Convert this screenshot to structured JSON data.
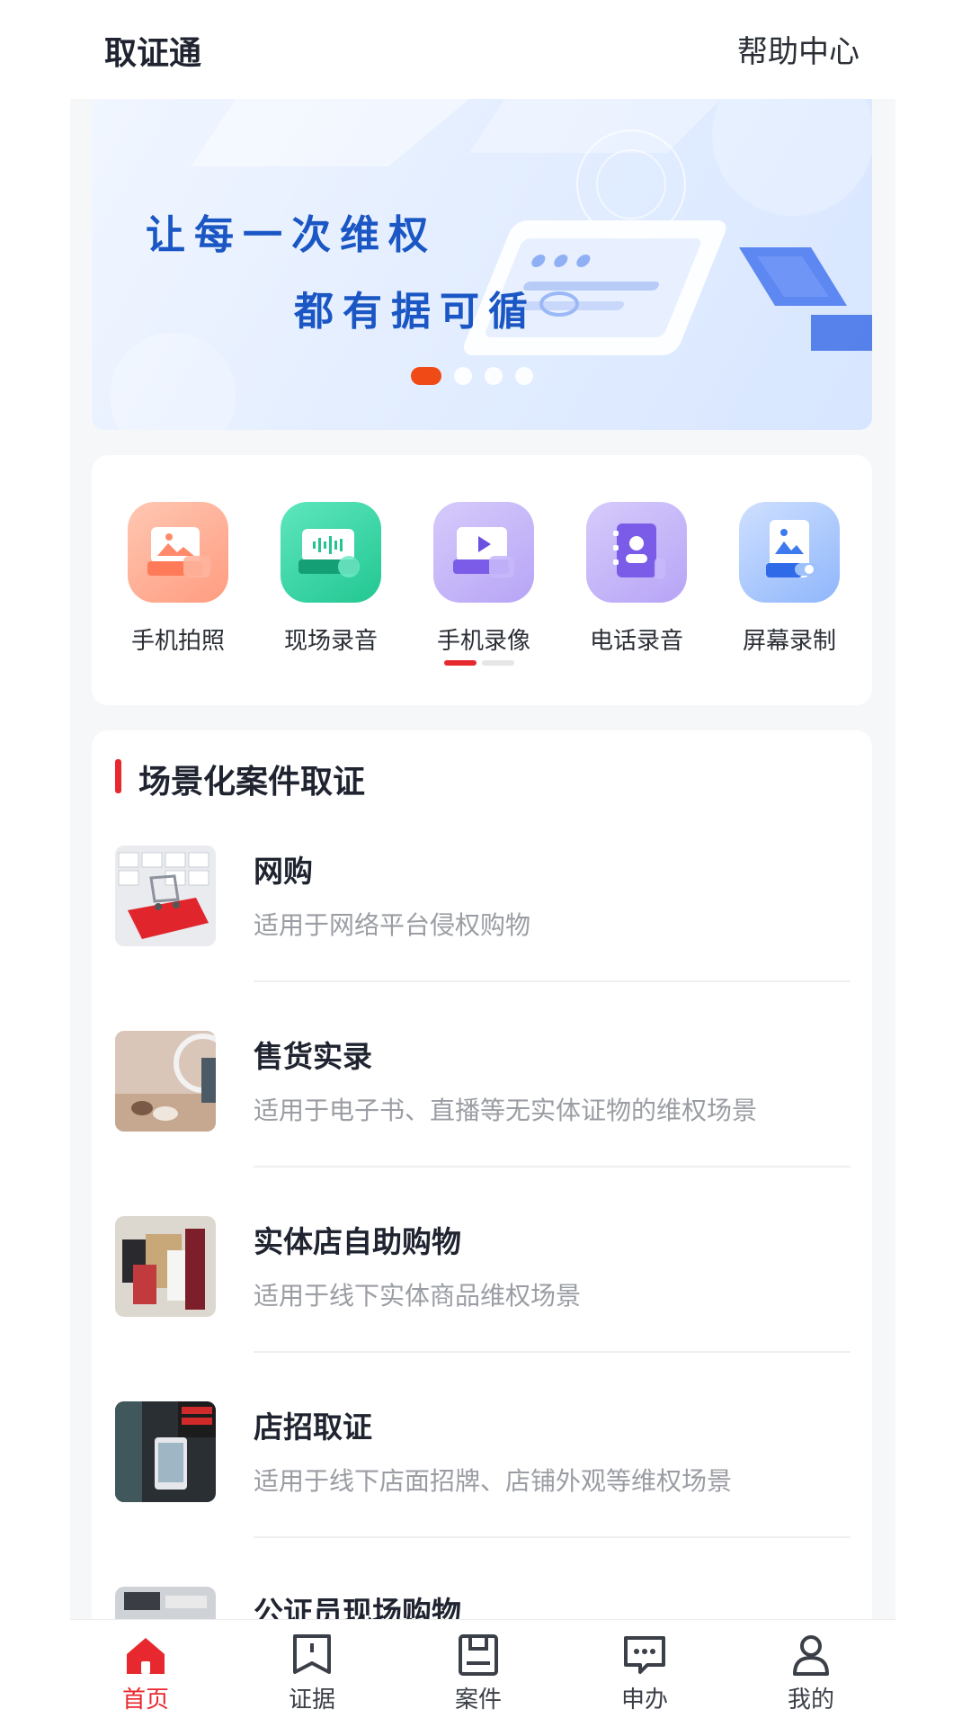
{
  "header": {
    "title": "取证通",
    "help": "帮助中心"
  },
  "banner": {
    "line1": "让每一次维权",
    "line2": "都有据可循",
    "slides": 4,
    "active_slide": 1
  },
  "tools": [
    {
      "label": "手机拍照",
      "icon": "camera-photo-icon",
      "color": "#ff8c6d"
    },
    {
      "label": "现场录音",
      "icon": "audio-record-icon",
      "color": "#2fd3a1"
    },
    {
      "label": "手机录像",
      "icon": "video-record-icon",
      "color": "#a58bf7"
    },
    {
      "label": "电话录音",
      "icon": "phone-record-icon",
      "color": "#a58bf7"
    },
    {
      "label": "屏幕录制",
      "icon": "screen-record-icon",
      "color": "#4f8ff7"
    }
  ],
  "scenarios": {
    "title": "场景化案件取证",
    "items": [
      {
        "name": "网购",
        "desc": "适用于网络平台侵权购物"
      },
      {
        "name": "售货实录",
        "desc": "适用于电子书、直播等无实体证物的维权场景"
      },
      {
        "name": "实体店自助购物",
        "desc": "适用于线下实体商品维权场景"
      },
      {
        "name": "店招取证",
        "desc": "适用于线下店面招牌、店铺外观等维权场景"
      },
      {
        "name": "公证员现场购物",
        "desc": ""
      }
    ]
  },
  "nav": [
    {
      "label": "首页",
      "icon": "home-icon",
      "active": true
    },
    {
      "label": "证据",
      "icon": "evidence-icon",
      "active": false
    },
    {
      "label": "案件",
      "icon": "case-icon",
      "active": false
    },
    {
      "label": "申办",
      "icon": "apply-icon",
      "active": false
    },
    {
      "label": "我的",
      "icon": "profile-icon",
      "active": false
    }
  ],
  "colors": {
    "accent": "#e8282f",
    "banner_text": "#1a56c4",
    "banner_dot": "#f04a16"
  }
}
